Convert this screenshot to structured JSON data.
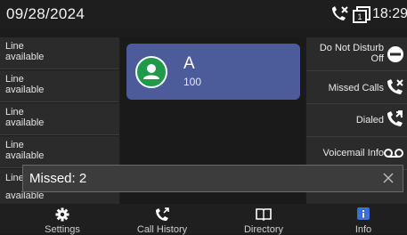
{
  "status_bar": {
    "date": "09/28/2024",
    "time": "18:29",
    "icons": [
      "missed-call-icon",
      "line-status-icon"
    ]
  },
  "line_keys": [
    {
      "line1": "Line",
      "line2": "available"
    },
    {
      "line1": "Line",
      "line2": "available"
    },
    {
      "line1": "Line",
      "line2": "available"
    },
    {
      "line1": "Line",
      "line2": "available"
    },
    {
      "line1": "Line",
      "line2": "available"
    }
  ],
  "line_card": {
    "name": "A",
    "extension": "100",
    "icon": "user-avatar-icon",
    "color": "#4c5b9a"
  },
  "function_keys": [
    {
      "label": "Do Not Disturb",
      "sublabel": "Off",
      "icon": "dnd-icon"
    },
    {
      "label": "Missed Calls",
      "icon": "missed-call-icon"
    },
    {
      "label": "Dialed",
      "icon": "dialed-call-icon"
    },
    {
      "label": "Voicemail Info",
      "icon": "voicemail-icon"
    }
  ],
  "notification": {
    "text": "Missed: 2",
    "close_icon": "close-icon"
  },
  "bottom_nav": [
    {
      "label": "Settings",
      "icon": "gear-icon"
    },
    {
      "label": "Call History",
      "icon": "call-history-icon"
    },
    {
      "label": "Directory",
      "icon": "book-icon"
    },
    {
      "label": "Info",
      "icon": "info-icon",
      "accent": "#3b6fd6"
    }
  ]
}
